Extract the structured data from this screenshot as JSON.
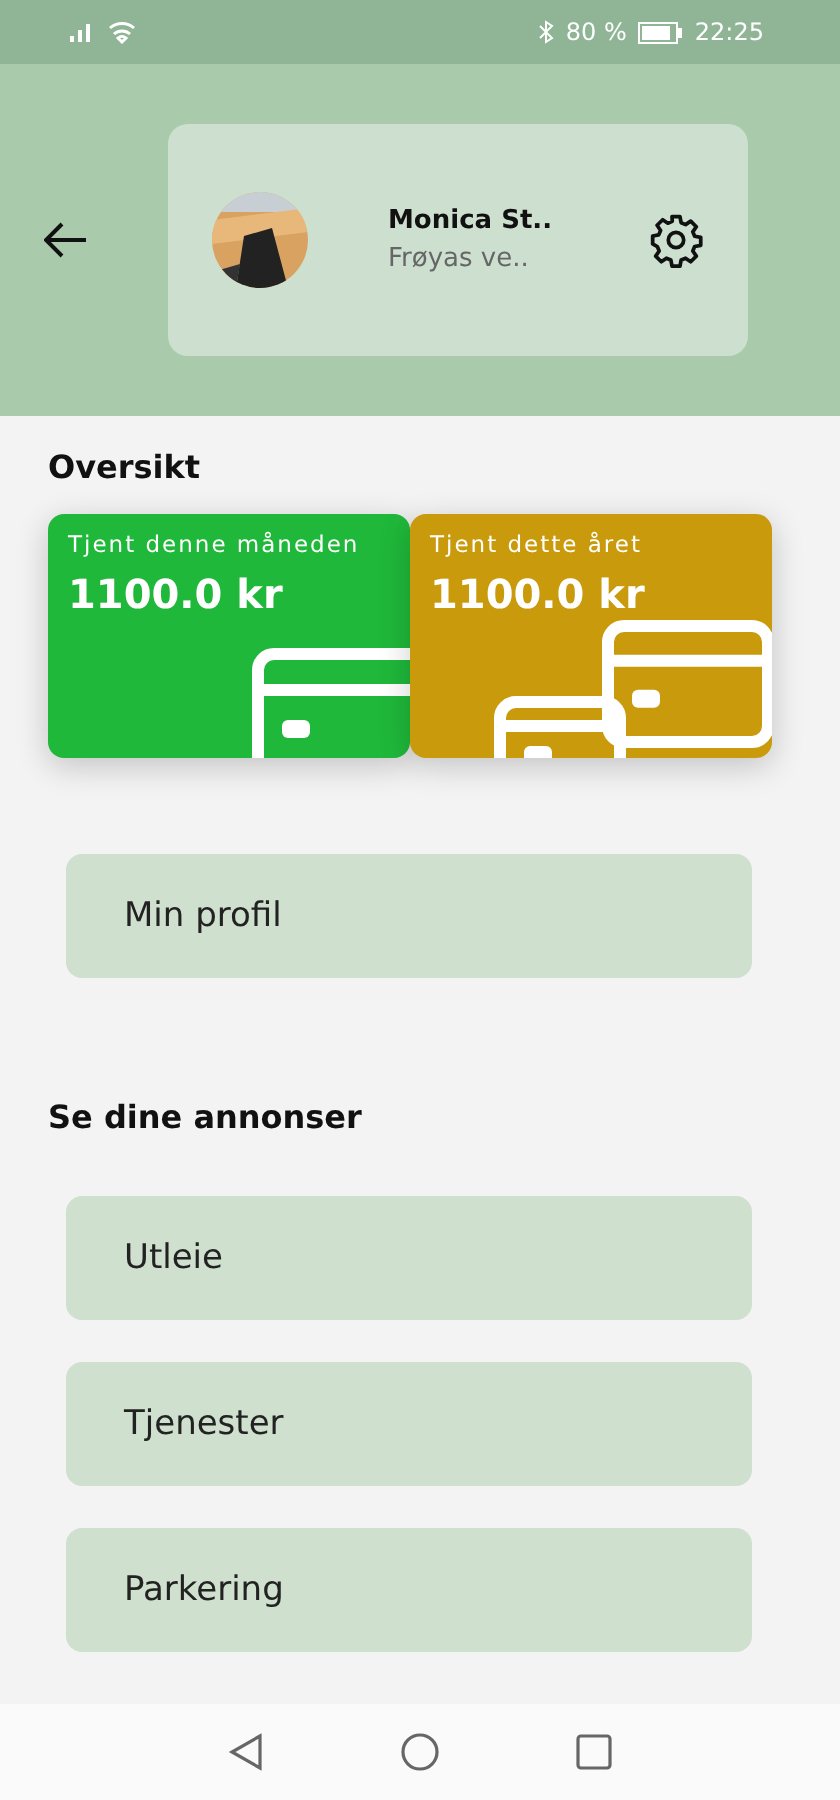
{
  "status_bar": {
    "battery_percent": "80 %",
    "time": "22:25"
  },
  "profile": {
    "name": "Monica St..",
    "subtitle": "Frøyas ve.."
  },
  "overview": {
    "title": "Oversikt",
    "cards": [
      {
        "kind": "single",
        "label": "Tjent denne måneden",
        "amount": "1100.0 kr",
        "color": "#1fb83a"
      },
      {
        "kind": "double",
        "label": "Tjent dette året",
        "amount": "1100.0 kr",
        "color": "#c99a0c"
      }
    ]
  },
  "profile_button": "Min profil",
  "listings": {
    "title": "Se dine annonser",
    "items": [
      "Utleie",
      "Tjenester",
      "Parkering"
    ]
  }
}
